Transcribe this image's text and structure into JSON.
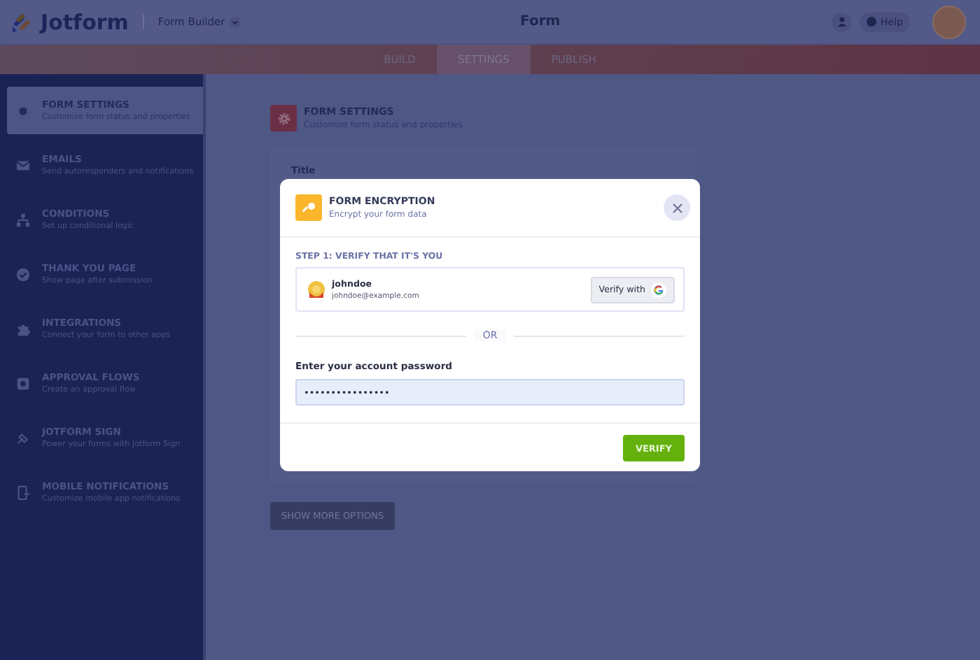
{
  "header": {
    "logo": "Jotform",
    "app_switcher": "Form Builder",
    "title": "Form",
    "help": "Help"
  },
  "tabs": [
    {
      "label": "BUILD",
      "selected": false
    },
    {
      "label": "SETTINGS",
      "selected": true
    },
    {
      "label": "PUBLISH",
      "selected": false
    }
  ],
  "sidebar": {
    "items": [
      {
        "title": "FORM SETTINGS",
        "subtitle": "Customize form status and properties",
        "selected": true
      },
      {
        "title": "EMAILS",
        "subtitle": "Send autoresponders and notifications",
        "selected": false
      },
      {
        "title": "CONDITIONS",
        "subtitle": "Set up conditional logic",
        "selected": false
      },
      {
        "title": "THANK YOU PAGE",
        "subtitle": "Show page after submission",
        "selected": false
      },
      {
        "title": "INTEGRATIONS",
        "subtitle": "Connect your form to other apps",
        "selected": false
      },
      {
        "title": "APPROVAL FLOWS",
        "subtitle": "Create an approval flow",
        "selected": false
      },
      {
        "title": "JOTFORM SIGN",
        "subtitle": "Power your forms with Jotform Sign",
        "selected": false
      },
      {
        "title": "MOBILE NOTIFICATIONS",
        "subtitle": "Customize mobile app notifications",
        "selected": false
      }
    ]
  },
  "main": {
    "heading": "FORM SETTINGS",
    "subheading": "Customize form status and properties",
    "field_label": "Title",
    "show_more_button": "SHOW MORE OPTIONS"
  },
  "modal": {
    "title": "FORM ENCRYPTION",
    "subtitle": "Encrypt your form data",
    "step_label": "STEP 1: VERIFY THAT IT'S YOU",
    "account": {
      "username": "johndoe",
      "email": "johndoe@example.com"
    },
    "verify_with_button": "Verify with",
    "divider_text": "OR",
    "password_label": "Enter your account password",
    "password_value": "••••••••••••••••",
    "verify_button": "VERIFY"
  }
}
